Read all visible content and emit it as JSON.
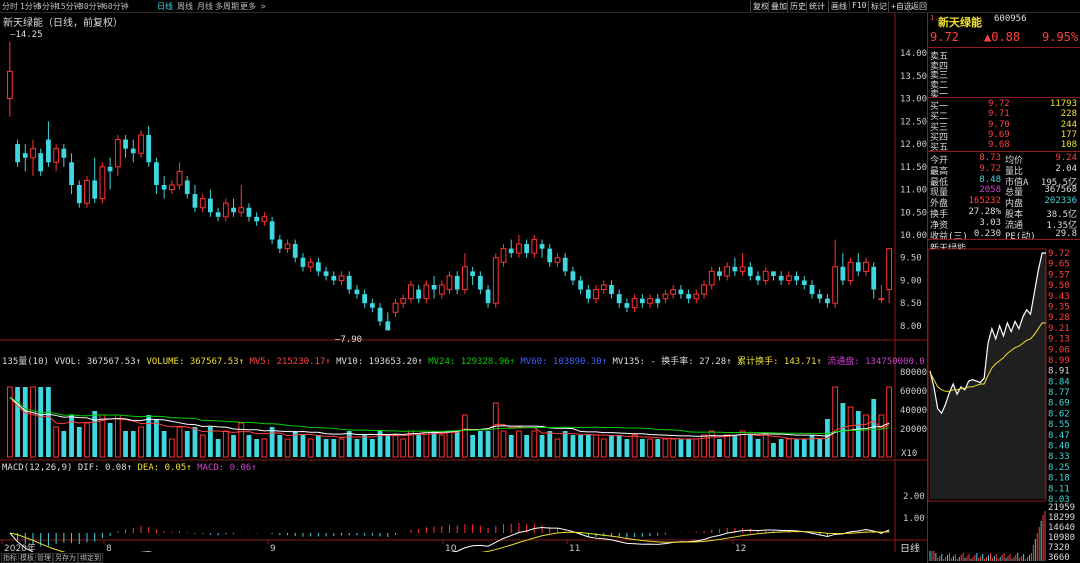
{
  "toolbar": {
    "periods": [
      "分时",
      "1分钟",
      "5分钟",
      "15分钟",
      "30分钟",
      "60分钟",
      "日线",
      "周线",
      "月线",
      "多周期",
      "更多 >"
    ],
    "active_period": "日线",
    "right_buttons": [
      "复权",
      "叠加",
      "历史",
      "统计",
      "画线",
      "F10",
      "标记",
      "+自选",
      "返回"
    ]
  },
  "chart_title": "新天绿能（日线，前复权）",
  "price_axis_labels": [
    "14.00",
    "13.50",
    "13.00",
    "12.50",
    "12.00",
    "11.50",
    "11.00",
    "10.50",
    "10.00",
    "9.50",
    "9.00",
    "8.50",
    "8.00"
  ],
  "high_marker": "14.25",
  "low_marker": "7.90",
  "indicator_line": {
    "prefix": "135量(10) VVOL: 367567.53↑",
    "volume": "VOLUME: 367567.53↑",
    "mv5": "MV5: 215230.17↑",
    "mv10": "MV10: 193653.20↑",
    "mv24": "MV24: 129328.96↑",
    "mv60": "MV60: 103890.30↑",
    "mv135": "MV135: -",
    "turnover": "换手率: 27.28↑",
    "cum_turnover": "累计换手: 143.71↑",
    "float": "流通盘: 134750000.0"
  },
  "volume_axis_labels": [
    "80000",
    "60000",
    "40000",
    "20000"
  ],
  "volume_unit": "X10",
  "macd_line": {
    "name": "MACD(12,26,9)",
    "dif": "DIF: 0.08↑",
    "dea": "DEA: 0.05↑",
    "macd": "MACD: 0.06↑"
  },
  "macd_axis_labels": [
    "2.00",
    "1.00"
  ],
  "x_axis_labels": [
    "2020年",
    "8",
    "9",
    "10",
    "11",
    "12"
  ],
  "period_label": "日线",
  "bottom_tabs": [
    "指标",
    "模板",
    "管理",
    "另存为",
    "绑定到"
  ],
  "quote": {
    "name": "新天绿能",
    "code": "600956",
    "price": "9.72",
    "change": "▲0.88",
    "change_pct": "9.95%",
    "asks": [
      {
        "label": "卖五",
        "price": "",
        "vol": ""
      },
      {
        "label": "卖四",
        "price": "",
        "vol": ""
      },
      {
        "label": "卖三",
        "price": "",
        "vol": ""
      },
      {
        "label": "卖二",
        "price": "",
        "vol": ""
      },
      {
        "label": "卖一",
        "price": "",
        "vol": ""
      }
    ],
    "bids": [
      {
        "label": "买一",
        "price": "9.72",
        "vol": "11793"
      },
      {
        "label": "买二",
        "price": "9.71",
        "vol": "228"
      },
      {
        "label": "买三",
        "price": "9.70",
        "vol": "244"
      },
      {
        "label": "买四",
        "price": "9.69",
        "vol": "177"
      },
      {
        "label": "买五",
        "price": "9.68",
        "vol": "108"
      }
    ],
    "stats": [
      {
        "l1": "今开",
        "v1": "8.73",
        "l2": "均价",
        "v2": "9.24"
      },
      {
        "l1": "最高",
        "v1": "9.72",
        "l2": "量比",
        "v2": "2.04"
      },
      {
        "l1": "最低",
        "v1": "8.48",
        "l2": "市值A",
        "v2": "195.5亿"
      },
      {
        "l1": "现量",
        "v1": "2058",
        "l2": "总量",
        "v2": "367568"
      },
      {
        "l1": "外盘",
        "v1": "165232",
        "l2": "内盘",
        "v2": "202336"
      },
      {
        "l1": "换手",
        "v1": "27.28%",
        "l2": "股本",
        "v2": "38.5亿"
      },
      {
        "l1": "净资",
        "v1": "3.03",
        "l2": "流通",
        "v2": "1.35亿"
      },
      {
        "l1": "收益(三)",
        "v1": "0.230",
        "l2": "PE(动)",
        "v2": "29.8"
      }
    ]
  },
  "intraday": {
    "title": "新天绿能",
    "price_labels": [
      "9.72",
      "9.65",
      "9.57",
      "9.50",
      "9.43",
      "9.35",
      "9.28",
      "9.21",
      "9.13",
      "9.06",
      "8.99",
      "8.91",
      "8.84",
      "8.77",
      "8.69",
      "8.62",
      "8.55",
      "8.47",
      "8.40",
      "8.33",
      "8.25",
      "8.18",
      "8.11",
      "8.03"
    ],
    "vol_labels": [
      "21959",
      "18299",
      "14640",
      "10980",
      "7320",
      "3660"
    ]
  },
  "colors": {
    "up": "#ff3333",
    "down": "#3fd7e0",
    "ma5": "#ffffff",
    "ma10": "#f0e030",
    "ma20": "#ff40ff",
    "ma60": "#00d000"
  },
  "chart_data": {
    "type": "candlestick",
    "ylim": [
      7.8,
      14.4
    ],
    "candles": [
      [
        13.0,
        13.6,
        12.6,
        14.25
      ],
      [
        12.0,
        11.6,
        11.5,
        12.1
      ],
      [
        11.8,
        11.7,
        11.4,
        12.0
      ],
      [
        11.7,
        11.9,
        11.3,
        12.1
      ],
      [
        11.8,
        11.4,
        11.3,
        11.9
      ],
      [
        12.1,
        11.6,
        11.5,
        12.5
      ],
      [
        11.6,
        11.9,
        11.4,
        12.0
      ],
      [
        11.9,
        11.7,
        11.5,
        12.0
      ],
      [
        11.6,
        11.1,
        10.9,
        11.8
      ],
      [
        11.1,
        10.7,
        10.6,
        11.2
      ],
      [
        10.7,
        11.2,
        10.6,
        11.3
      ],
      [
        11.2,
        10.8,
        10.7,
        11.7
      ],
      [
        10.8,
        11.5,
        10.7,
        11.6
      ],
      [
        11.5,
        11.4,
        11.0,
        11.7
      ],
      [
        11.5,
        12.1,
        11.3,
        12.2
      ],
      [
        12.1,
        11.9,
        11.7,
        12.2
      ],
      [
        11.9,
        11.8,
        11.6,
        12.1
      ],
      [
        11.8,
        12.2,
        11.7,
        12.3
      ],
      [
        12.2,
        11.6,
        11.5,
        12.4
      ],
      [
        11.6,
        11.1,
        10.9,
        11.7
      ],
      [
        11.1,
        11.0,
        10.8,
        11.3
      ],
      [
        11.0,
        11.1,
        10.9,
        11.2
      ],
      [
        11.1,
        11.4,
        11.0,
        11.6
      ],
      [
        11.2,
        10.9,
        10.8,
        11.3
      ],
      [
        10.9,
        10.6,
        10.5,
        11.1
      ],
      [
        10.6,
        10.8,
        10.5,
        10.9
      ],
      [
        10.8,
        10.5,
        10.4,
        11.0
      ],
      [
        10.5,
        10.4,
        10.3,
        10.6
      ],
      [
        10.4,
        10.7,
        10.3,
        10.8
      ],
      [
        10.6,
        10.5,
        10.4,
        10.8
      ],
      [
        10.5,
        10.6,
        10.4,
        11.1
      ],
      [
        10.6,
        10.4,
        10.3,
        10.7
      ],
      [
        10.4,
        10.3,
        10.2,
        10.5
      ],
      [
        10.3,
        10.4,
        10.2,
        10.5
      ],
      [
        10.3,
        9.9,
        9.8,
        10.4
      ],
      [
        9.9,
        9.7,
        9.6,
        10.0
      ],
      [
        9.7,
        9.8,
        9.6,
        9.9
      ],
      [
        9.8,
        9.5,
        9.4,
        9.9
      ],
      [
        9.5,
        9.3,
        9.2,
        9.6
      ],
      [
        9.3,
        9.4,
        9.2,
        9.5
      ],
      [
        9.4,
        9.2,
        9.1,
        9.5
      ],
      [
        9.2,
        9.1,
        9.0,
        9.3
      ],
      [
        9.1,
        9.0,
        8.9,
        9.2
      ],
      [
        9.0,
        9.1,
        8.9,
        9.2
      ],
      [
        9.1,
        8.8,
        8.7,
        9.2
      ],
      [
        8.8,
        8.7,
        8.6,
        8.9
      ],
      [
        8.7,
        8.5,
        8.4,
        8.8
      ],
      [
        8.5,
        8.4,
        8.3,
        8.6
      ],
      [
        8.4,
        8.1,
        8.0,
        8.5
      ],
      [
        8.1,
        7.9,
        7.9,
        8.3
      ],
      [
        8.3,
        8.5,
        8.2,
        8.6
      ],
      [
        8.5,
        8.6,
        8.4,
        8.7
      ],
      [
        8.6,
        8.9,
        8.5,
        9.0
      ],
      [
        8.8,
        8.6,
        8.5,
        8.9
      ],
      [
        8.6,
        8.9,
        8.5,
        9.0
      ],
      [
        8.9,
        8.8,
        8.6,
        9.1
      ],
      [
        8.7,
        8.9,
        8.6,
        9.0
      ],
      [
        8.8,
        9.1,
        8.7,
        9.2
      ],
      [
        9.1,
        8.8,
        8.7,
        9.2
      ],
      [
        8.8,
        9.3,
        8.7,
        9.6
      ],
      [
        9.2,
        9.1,
        8.9,
        9.3
      ],
      [
        9.1,
        8.8,
        8.7,
        9.2
      ],
      [
        8.8,
        8.5,
        8.4,
        8.9
      ],
      [
        8.5,
        9.5,
        8.4,
        9.6
      ],
      [
        9.4,
        9.7,
        9.3,
        9.8
      ],
      [
        9.7,
        9.6,
        9.5,
        9.9
      ],
      [
        9.6,
        9.8,
        9.5,
        10.0
      ],
      [
        9.8,
        9.6,
        9.5,
        9.9
      ],
      [
        9.6,
        9.9,
        9.5,
        10.0
      ],
      [
        9.8,
        9.7,
        9.5,
        9.9
      ],
      [
        9.7,
        9.4,
        9.3,
        9.8
      ],
      [
        9.4,
        9.5,
        9.3,
        9.6
      ],
      [
        9.5,
        9.2,
        9.1,
        9.6
      ],
      [
        9.2,
        9.0,
        8.9,
        9.3
      ],
      [
        9.0,
        8.8,
        8.7,
        9.1
      ],
      [
        8.8,
        8.6,
        8.5,
        8.9
      ],
      [
        8.6,
        8.8,
        8.5,
        8.9
      ],
      [
        8.8,
        8.9,
        8.7,
        9.0
      ],
      [
        8.9,
        8.7,
        8.6,
        9.0
      ],
      [
        8.7,
        8.5,
        8.4,
        8.8
      ],
      [
        8.5,
        8.4,
        8.3,
        8.6
      ],
      [
        8.4,
        8.6,
        8.3,
        8.7
      ],
      [
        8.6,
        8.5,
        8.4,
        8.7
      ],
      [
        8.5,
        8.6,
        8.4,
        8.7
      ],
      [
        8.6,
        8.5,
        8.4,
        8.7
      ],
      [
        8.6,
        8.7,
        8.5,
        8.8
      ],
      [
        8.7,
        8.8,
        8.6,
        8.9
      ],
      [
        8.8,
        8.7,
        8.6,
        8.9
      ],
      [
        8.7,
        8.6,
        8.5,
        8.8
      ],
      [
        8.6,
        8.7,
        8.5,
        8.8
      ],
      [
        8.7,
        8.9,
        8.6,
        9.0
      ],
      [
        8.9,
        9.2,
        8.8,
        9.3
      ],
      [
        9.2,
        9.1,
        9.0,
        9.3
      ],
      [
        9.1,
        9.3,
        9.0,
        9.4
      ],
      [
        9.3,
        9.2,
        9.1,
        9.5
      ],
      [
        9.2,
        9.3,
        9.1,
        9.6
      ],
      [
        9.3,
        9.1,
        9.0,
        9.4
      ],
      [
        9.1,
        9.0,
        8.9,
        9.2
      ],
      [
        9.0,
        9.2,
        8.9,
        9.3
      ],
      [
        9.2,
        9.1,
        9.0,
        9.2
      ],
      [
        9.1,
        9.0,
        8.9,
        9.2
      ],
      [
        9.0,
        9.1,
        8.9,
        9.2
      ],
      [
        9.1,
        9.0,
        8.9,
        9.2
      ],
      [
        9.0,
        8.9,
        8.8,
        9.1
      ],
      [
        8.9,
        8.7,
        8.6,
        9.0
      ],
      [
        8.7,
        8.6,
        8.5,
        8.8
      ],
      [
        8.6,
        8.5,
        8.4,
        8.7
      ],
      [
        8.5,
        9.3,
        8.4,
        9.9
      ],
      [
        9.3,
        9.0,
        8.9,
        9.6
      ],
      [
        9.0,
        9.4,
        8.9,
        9.5
      ],
      [
        9.4,
        9.2,
        9.1,
        9.6
      ],
      [
        9.2,
        9.4,
        9.1,
        9.5
      ],
      [
        9.3,
        8.8,
        8.6,
        9.4
      ],
      [
        8.6,
        8.6,
        8.5,
        8.9
      ],
      [
        8.8,
        9.7,
        8.5,
        9.72
      ]
    ]
  }
}
